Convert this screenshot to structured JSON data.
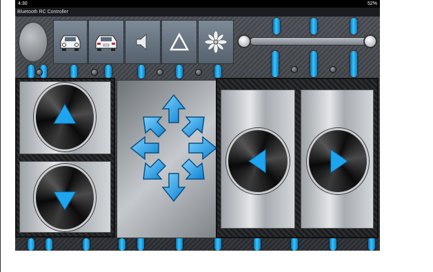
{
  "statusbar": {
    "time": "4:30",
    "right": "52%"
  },
  "app": {
    "title": "Bluetooth RC Controller"
  },
  "toolbar": {
    "buttons": [
      {
        "name": "front-lights-toggle",
        "icon": "car-front-icon"
      },
      {
        "name": "back-lights-toggle",
        "icon": "car-back-icon"
      },
      {
        "name": "horn-toggle",
        "icon": "speaker-icon"
      },
      {
        "name": "extra-toggle",
        "icon": "warning-triangle-icon"
      },
      {
        "name": "settings-toggle",
        "icon": "fan-icon"
      }
    ]
  },
  "colors": {
    "accent": "#1ea7f0",
    "pipe": "#35c6ff",
    "panel": "#1b1c1e"
  }
}
